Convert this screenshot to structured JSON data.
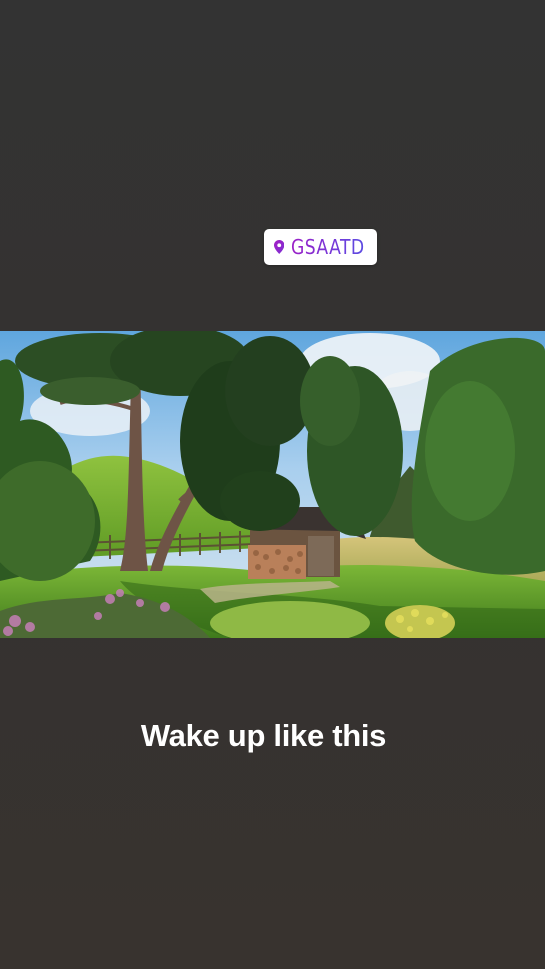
{
  "location_sticker": {
    "icon": "location-pin-icon",
    "text": "GSAATD",
    "colors": [
      "#9b1fc7",
      "#5b4ce2"
    ]
  },
  "photo": {
    "subject": "mountain meadow with pine tree and wooden woodshed"
  },
  "caption": {
    "text": "Wake up like this"
  },
  "colors": {
    "background": "#343230",
    "caption_text": "#ffffff"
  }
}
